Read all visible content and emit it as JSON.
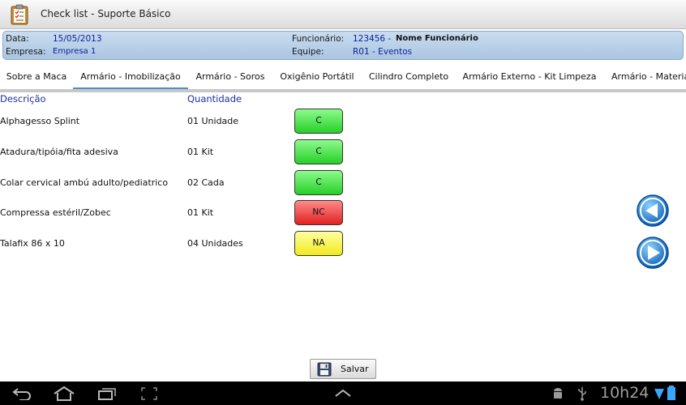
{
  "app": {
    "title": "Check list - Suporte Básico"
  },
  "header": {
    "date_label": "Data:",
    "date_value": "15/05/2013",
    "company_label": "Empresa:",
    "company_value": "Empresa 1",
    "employee_label": "Funcionário:",
    "employee_id": "123456 -",
    "employee_name": "Nome Funcionário",
    "team_label": "Equipe:",
    "team_value": "R01 - Eventos"
  },
  "tabs": [
    {
      "label": "Sobre a Maca"
    },
    {
      "label": "Armário - Imobilização",
      "active": true
    },
    {
      "label": "Armário - Soros"
    },
    {
      "label": "Oxigênio Portátil"
    },
    {
      "label": "Cilindro Completo"
    },
    {
      "label": "Armário Externo - Kit Limpeza"
    },
    {
      "label": "Armário - Materia"
    }
  ],
  "columns": {
    "description": "Descrição",
    "quantity": "Quantidade"
  },
  "items": [
    {
      "description": "Alphagesso Splint",
      "quantity": "01 Unidade",
      "status": "C"
    },
    {
      "description": "Atadura/tipóia/fita adesiva",
      "quantity": "01 Kit",
      "status": "C"
    },
    {
      "description": "Colar cervical ambú adulto/pediatrico",
      "quantity": "02 Cada",
      "status": "C"
    },
    {
      "description": "Compressa estéril/Zobec",
      "quantity": "01 Kit",
      "status": "NC"
    },
    {
      "description": "Talafix 86 x 10",
      "quantity": "04 Unidades",
      "status": "NA"
    }
  ],
  "status_colors": {
    "C": "#27cf27",
    "NC": "#e02121",
    "NA": "#f1ea1c"
  },
  "navigation": {
    "prev_icon": "arrow-left-icon",
    "next_icon": "arrow-right-icon"
  },
  "save": {
    "label": "Salvar",
    "icon": "floppy-disk-icon"
  },
  "system_bar": {
    "time": "10h24"
  },
  "colors": {
    "accent": "#4a8ed6",
    "header_panel": "#bcd2ea",
    "link_text": "#1b2fa3"
  }
}
